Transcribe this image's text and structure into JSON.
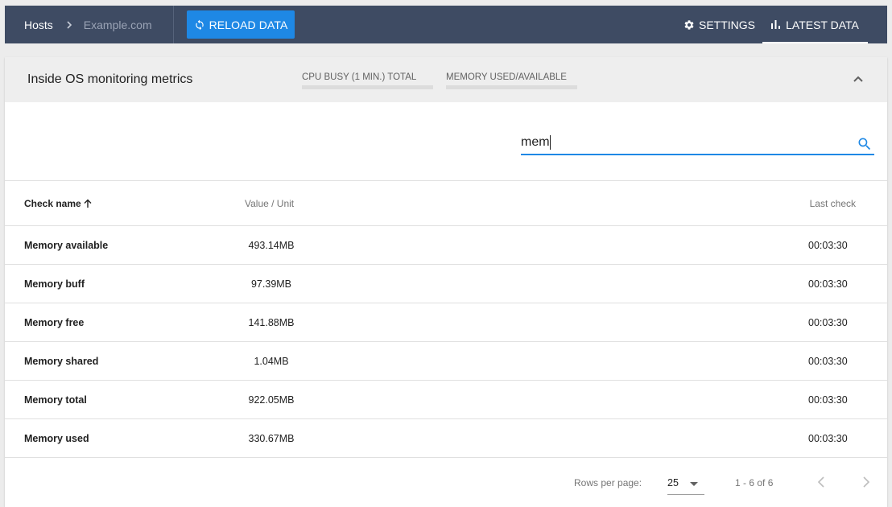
{
  "topbar": {
    "breadcrumb": {
      "root": "Hosts",
      "current": "Example.com"
    },
    "reload_label": "RELOAD DATA",
    "settings_label": "SETTINGS",
    "latest_label": "LATEST DATA"
  },
  "card": {
    "title": "Inside OS monitoring metrics",
    "chips": {
      "cpu": "CPU BUSY (1 MIN.) TOTAL",
      "memory": "MEMORY USED/AVAILABLE"
    }
  },
  "search": {
    "value": "mem",
    "placeholder": ""
  },
  "table": {
    "headers": {
      "name": "Check name",
      "value": "Value / Unit",
      "last": "Last check"
    },
    "rows": [
      {
        "name": "Memory available",
        "value": "493.14MB",
        "last": "00:03:30"
      },
      {
        "name": "Memory buff",
        "value": "97.39MB",
        "last": "00:03:30"
      },
      {
        "name": "Memory free",
        "value": "141.88MB",
        "last": "00:03:30"
      },
      {
        "name": "Memory shared",
        "value": "1.04MB",
        "last": "00:03:30"
      },
      {
        "name": "Memory total",
        "value": "922.05MB",
        "last": "00:03:30"
      },
      {
        "name": "Memory used",
        "value": "330.67MB",
        "last": "00:03:30"
      }
    ]
  },
  "pagination": {
    "rows_per_page_label": "Rows per page:",
    "rows_per_page": "25",
    "range": "1 - 6 of 6"
  },
  "colors": {
    "topbar": "#3e4b63",
    "accent": "#1e88e5"
  },
  "icons": [
    "chevron-right-icon",
    "refresh-icon",
    "gear-icon",
    "bar-chart-icon",
    "chevron-up-icon",
    "search-icon",
    "arrow-up-icon",
    "caret-down-icon",
    "chevron-left-icon"
  ]
}
